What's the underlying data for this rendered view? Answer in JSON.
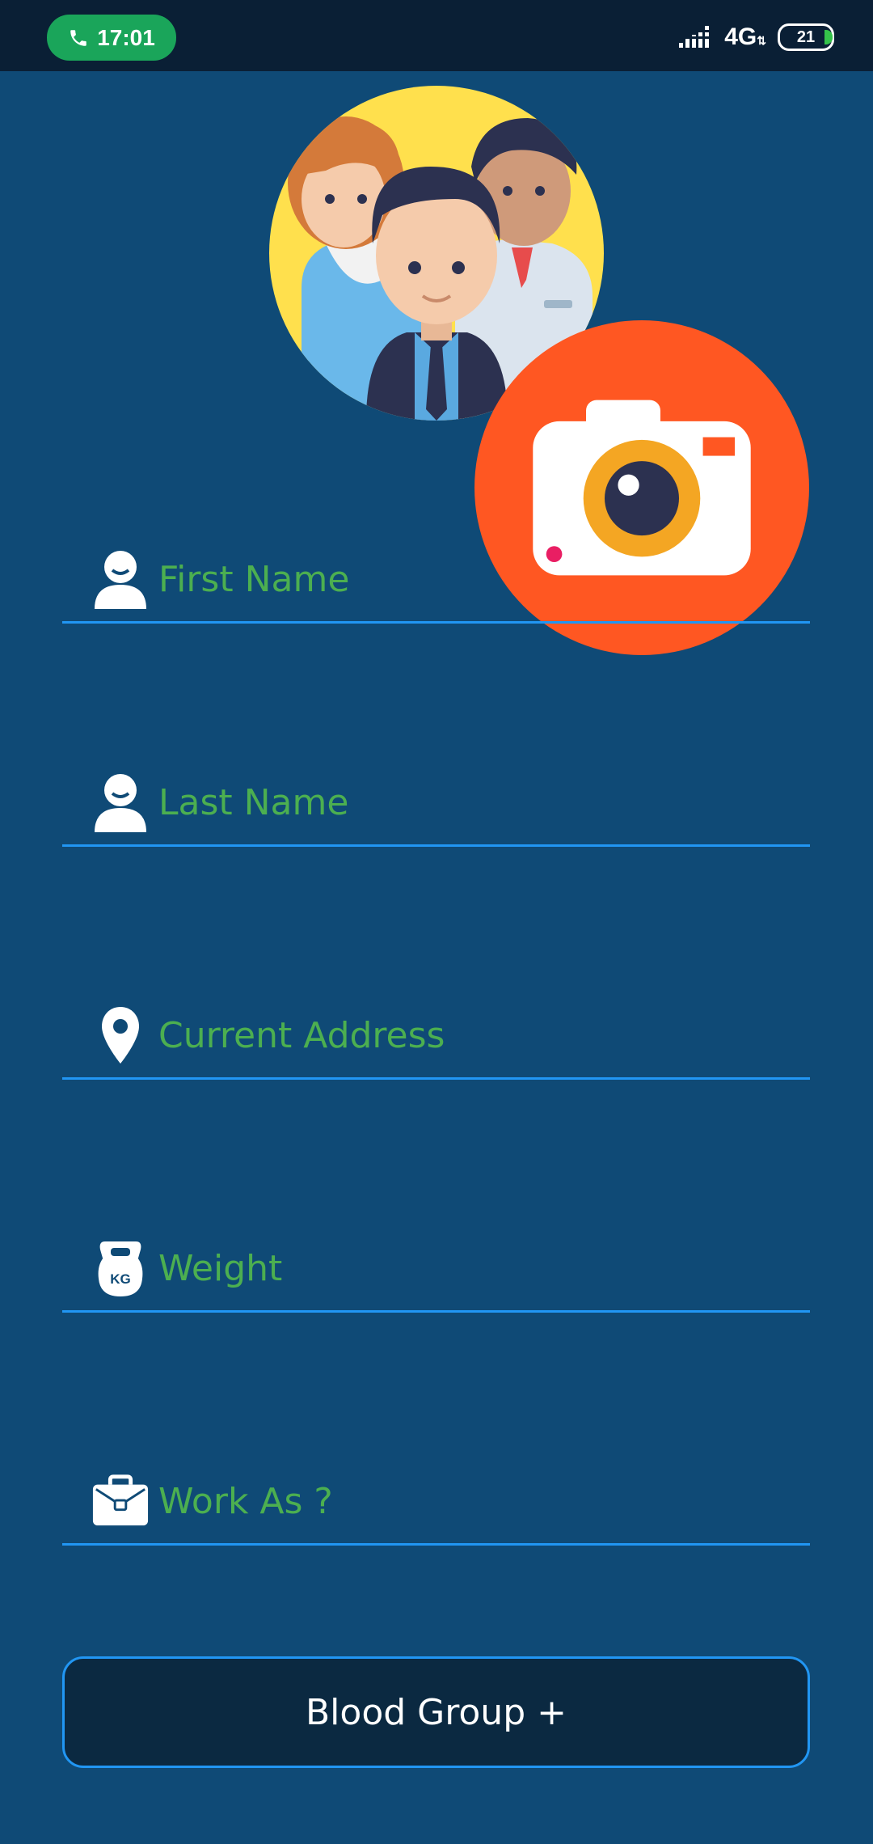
{
  "status_bar": {
    "time": "17:01",
    "network": "4G",
    "battery": "21"
  },
  "profile": {
    "avatar_icon": "team-avatar-icon",
    "camera_icon": "camera-icon"
  },
  "form": {
    "first_name": {
      "placeholder": "First Name",
      "icon": "person-icon"
    },
    "last_name": {
      "placeholder": "Last Name",
      "icon": "person-icon"
    },
    "address": {
      "placeholder": "Current Address",
      "icon": "location-pin-icon"
    },
    "weight": {
      "placeholder": "Weight",
      "icon": "kettlebell-icon"
    },
    "work": {
      "placeholder": "Work As ?",
      "icon": "briefcase-icon"
    },
    "blood_group_label": "Blood Group +"
  },
  "colors": {
    "background": "#0f4a76",
    "status_bar": "#0a1f35",
    "accent_line": "#2196f3",
    "placeholder_text": "#4caf50",
    "call_pill": "#1aa55a"
  }
}
